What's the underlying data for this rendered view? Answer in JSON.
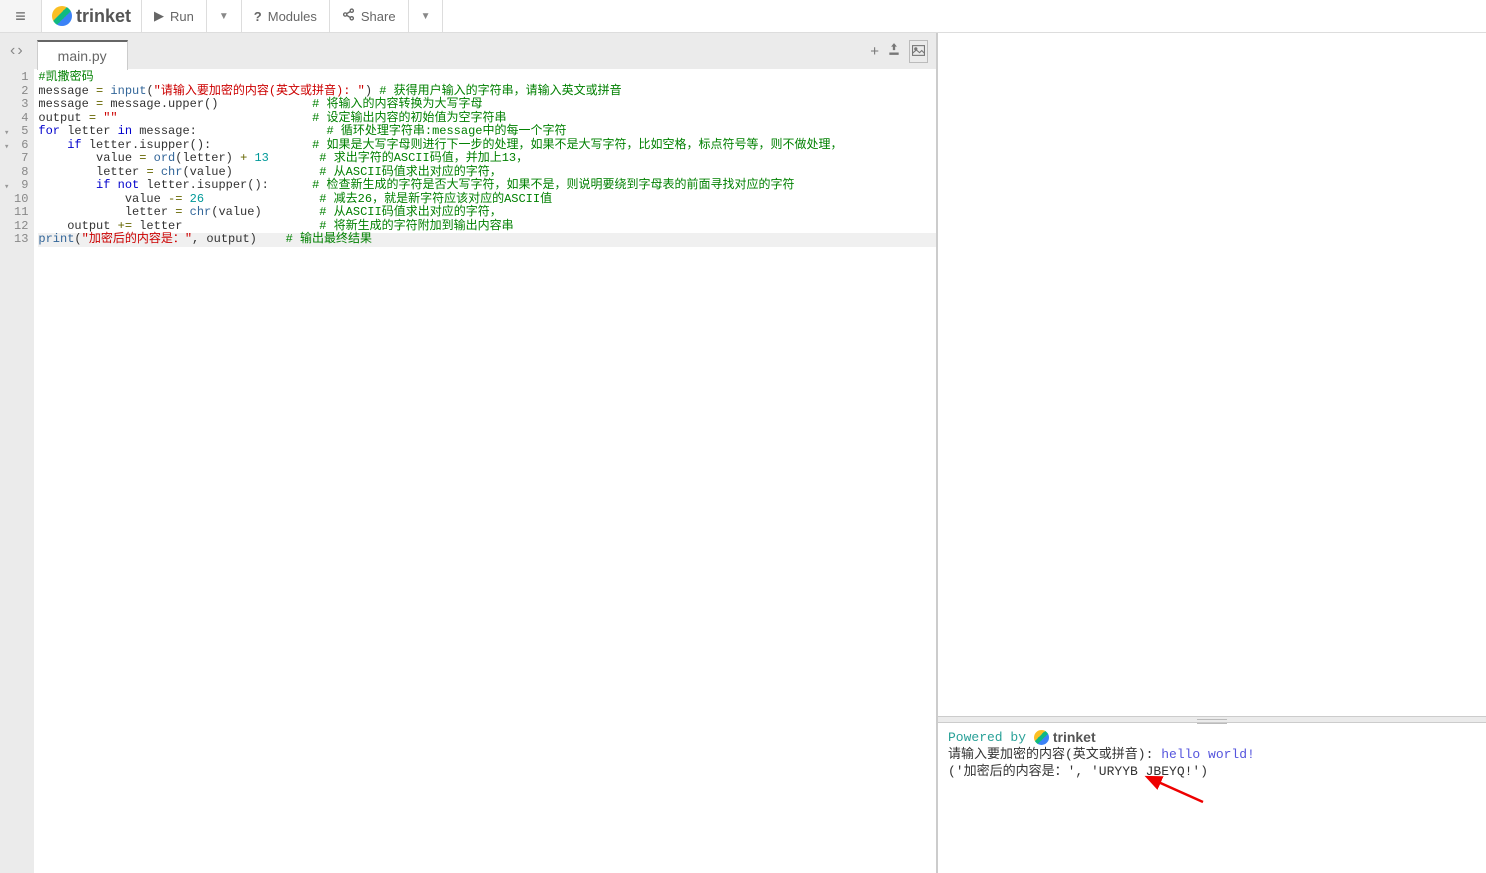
{
  "toolbar": {
    "run": "Run",
    "modules": "Modules",
    "share": "Share",
    "brand": "trinket"
  },
  "tabs": {
    "file": "main.py"
  },
  "code": {
    "lines": [
      {
        "n": 1,
        "fold": "",
        "segs": [
          {
            "c": "comment",
            "t": "#凯撒密码"
          }
        ]
      },
      {
        "n": 2,
        "fold": "",
        "segs": [
          {
            "c": "",
            "t": "message "
          },
          {
            "c": "op",
            "t": "="
          },
          {
            "c": "",
            "t": " "
          },
          {
            "c": "builtin",
            "t": "input"
          },
          {
            "c": "",
            "t": "("
          },
          {
            "c": "string",
            "t": "\"请输入要加密的内容(英文或拼音): \""
          },
          {
            "c": "",
            "t": ") "
          },
          {
            "c": "comment",
            "t": "# 获得用户输入的字符串，请输入英文或拼音"
          }
        ]
      },
      {
        "n": 3,
        "fold": "",
        "segs": [
          {
            "c": "",
            "t": "message "
          },
          {
            "c": "op",
            "t": "="
          },
          {
            "c": "",
            "t": " message.upper()             "
          },
          {
            "c": "comment",
            "t": "# 将输入的内容转换为大写字母"
          }
        ]
      },
      {
        "n": 4,
        "fold": "",
        "segs": [
          {
            "c": "",
            "t": "output "
          },
          {
            "c": "op",
            "t": "="
          },
          {
            "c": "",
            "t": " "
          },
          {
            "c": "string",
            "t": "\"\""
          },
          {
            "c": "",
            "t": "                           "
          },
          {
            "c": "comment",
            "t": "# 设定输出内容的初始值为空字符串"
          }
        ]
      },
      {
        "n": 5,
        "fold": "▾",
        "segs": [
          {
            "c": "keyword",
            "t": "for"
          },
          {
            "c": "",
            "t": " letter "
          },
          {
            "c": "keyword",
            "t": "in"
          },
          {
            "c": "",
            "t": " message:                  "
          },
          {
            "c": "comment",
            "t": "# 循环处理字符串:message中的每一个字符"
          }
        ]
      },
      {
        "n": 6,
        "fold": "▾",
        "segs": [
          {
            "c": "",
            "t": "    "
          },
          {
            "c": "keyword",
            "t": "if"
          },
          {
            "c": "",
            "t": " letter.isupper():              "
          },
          {
            "c": "comment",
            "t": "# 如果是大写字母则进行下一步的处理，如果不是大写字符，比如空格，标点符号等，则不做处理，"
          }
        ]
      },
      {
        "n": 7,
        "fold": "",
        "segs": [
          {
            "c": "",
            "t": "        value "
          },
          {
            "c": "op",
            "t": "="
          },
          {
            "c": "",
            "t": " "
          },
          {
            "c": "builtin",
            "t": "ord"
          },
          {
            "c": "",
            "t": "(letter) "
          },
          {
            "c": "op",
            "t": "+"
          },
          {
            "c": "",
            "t": " "
          },
          {
            "c": "number",
            "t": "13"
          },
          {
            "c": "",
            "t": "       "
          },
          {
            "c": "comment",
            "t": "# 求出字符的ASCII码值，并加上13，"
          }
        ]
      },
      {
        "n": 8,
        "fold": "",
        "segs": [
          {
            "c": "",
            "t": "        letter "
          },
          {
            "c": "op",
            "t": "="
          },
          {
            "c": "",
            "t": " "
          },
          {
            "c": "builtin",
            "t": "chr"
          },
          {
            "c": "",
            "t": "(value)            "
          },
          {
            "c": "comment",
            "t": "# 从ASCII码值求出对应的字符，"
          }
        ]
      },
      {
        "n": 9,
        "fold": "▾",
        "segs": [
          {
            "c": "",
            "t": "        "
          },
          {
            "c": "keyword",
            "t": "if"
          },
          {
            "c": "",
            "t": " "
          },
          {
            "c": "keyword",
            "t": "not"
          },
          {
            "c": "",
            "t": " letter.isupper():      "
          },
          {
            "c": "comment",
            "t": "# 检查新生成的字符是否大写字符，如果不是，则说明要绕到字母表的前面寻找对应的字符"
          }
        ]
      },
      {
        "n": 10,
        "fold": "",
        "segs": [
          {
            "c": "",
            "t": "            value "
          },
          {
            "c": "op",
            "t": "-="
          },
          {
            "c": "",
            "t": " "
          },
          {
            "c": "number",
            "t": "26"
          },
          {
            "c": "",
            "t": "                "
          },
          {
            "c": "comment",
            "t": "# 减去26，就是新字符应该对应的ASCII值"
          }
        ]
      },
      {
        "n": 11,
        "fold": "",
        "segs": [
          {
            "c": "",
            "t": "            letter "
          },
          {
            "c": "op",
            "t": "="
          },
          {
            "c": "",
            "t": " "
          },
          {
            "c": "builtin",
            "t": "chr"
          },
          {
            "c": "",
            "t": "(value)        "
          },
          {
            "c": "comment",
            "t": "# 从ASCII码值求出对应的字符，"
          }
        ]
      },
      {
        "n": 12,
        "fold": "",
        "segs": [
          {
            "c": "",
            "t": "    output "
          },
          {
            "c": "op",
            "t": "+="
          },
          {
            "c": "",
            "t": " letter                   "
          },
          {
            "c": "comment",
            "t": "# 将新生成的字符附加到输出内容串"
          }
        ]
      },
      {
        "n": 13,
        "fold": "",
        "active": true,
        "segs": [
          {
            "c": "builtin",
            "t": "print"
          },
          {
            "c": "",
            "t": "("
          },
          {
            "c": "string",
            "t": "\"加密后的内容是：\""
          },
          {
            "c": "",
            "t": ", output)    "
          },
          {
            "c": "comment",
            "t": "# 输出最终结果"
          }
        ]
      }
    ]
  },
  "console": {
    "powered": "Powered by ",
    "brand": "trinket",
    "prompt": "请输入要加密的内容(英文或拼音):  ",
    "input": "hello world!",
    "result": "('加密后的内容是：', 'URYYB JBEYQ!')"
  }
}
